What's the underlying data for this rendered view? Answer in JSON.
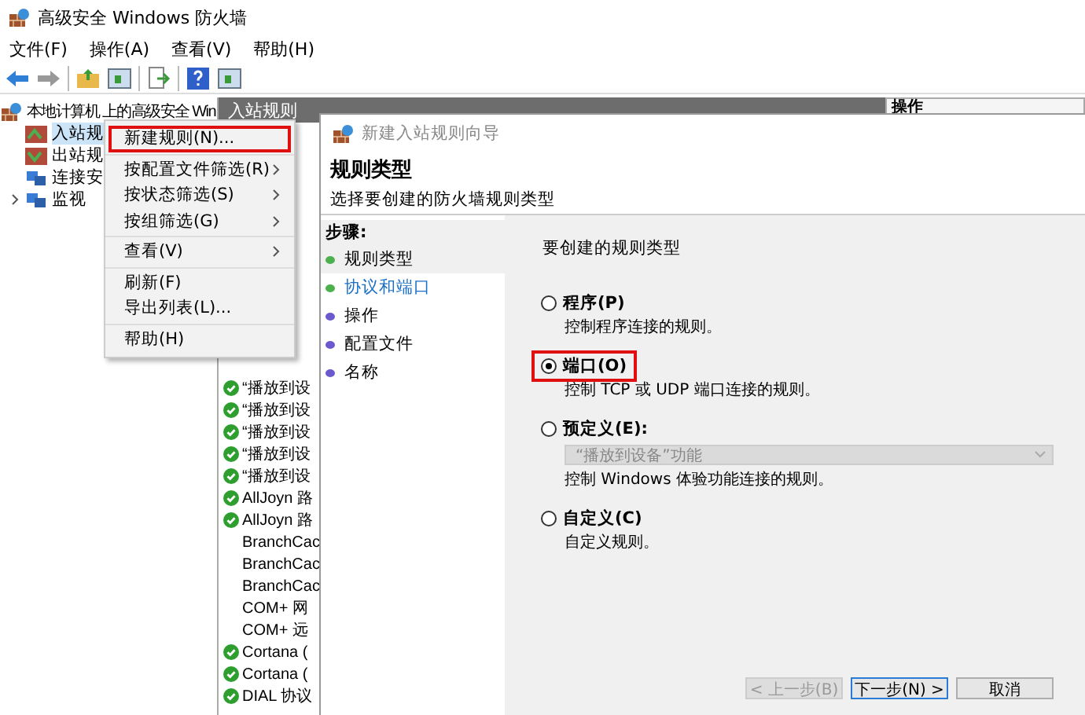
{
  "window": {
    "title": "高级安全 Windows 防火墙"
  },
  "menu_bar": [
    "文件(F)",
    "操作(A)",
    "查看(V)",
    "帮助(H)"
  ],
  "tree": {
    "root": "本地计算机 上的高级安全 Win",
    "children": [
      {
        "label": "入站规",
        "expandable": false,
        "selected": true
      },
      {
        "label": "出站规",
        "expandable": false,
        "selected": false
      },
      {
        "label": "连接安",
        "expandable": false,
        "selected": false
      },
      {
        "label": "监视",
        "expandable": true,
        "selected": false
      }
    ]
  },
  "middle_pane": {
    "title": "入站规则",
    "rows": [
      {
        "name": "“播放到设",
        "enabled": true
      },
      {
        "name": "“播放到设",
        "enabled": true
      },
      {
        "name": "“播放到设",
        "enabled": true
      },
      {
        "name": "“播放到设",
        "enabled": true
      },
      {
        "name": "“播放到设",
        "enabled": true
      },
      {
        "name": "AllJoyn 路",
        "enabled": true
      },
      {
        "name": "AllJoyn 路",
        "enabled": true
      },
      {
        "name": "BranchCac",
        "enabled": false
      },
      {
        "name": "BranchCac",
        "enabled": false
      },
      {
        "name": "BranchCac",
        "enabled": false
      },
      {
        "name": "COM+ 网",
        "enabled": false
      },
      {
        "name": "COM+ 远",
        "enabled": false
      },
      {
        "name": "Cortana (",
        "enabled": true
      },
      {
        "name": "Cortana (",
        "enabled": true
      },
      {
        "name": "DIAL 协议",
        "enabled": true
      }
    ]
  },
  "actions_pane": {
    "title": "操作"
  },
  "context_menu": {
    "groups": [
      [
        {
          "label": "新建规则(N)...",
          "submenu": false,
          "highlighted": true
        }
      ],
      [
        {
          "label": "按配置文件筛选(R)",
          "submenu": true,
          "highlighted": false
        },
        {
          "label": "按状态筛选(S)",
          "submenu": true,
          "highlighted": false
        },
        {
          "label": "按组筛选(G)",
          "submenu": true,
          "highlighted": false
        }
      ],
      [
        {
          "label": "查看(V)",
          "submenu": true,
          "highlighted": false
        }
      ],
      [
        {
          "label": "刷新(F)",
          "submenu": false,
          "highlighted": false
        },
        {
          "label": "导出列表(L)...",
          "submenu": false,
          "highlighted": false
        }
      ],
      [
        {
          "label": "帮助(H)",
          "submenu": false,
          "highlighted": false
        }
      ]
    ]
  },
  "wizard": {
    "title": "新建入站规则向导",
    "heading": "规则类型",
    "subheading": "选择要创建的防火墙规则类型",
    "steps_title": "步骤:",
    "steps": [
      {
        "label": "规则类型",
        "color": "#4cb04c",
        "selected": true,
        "link": false
      },
      {
        "label": "协议和端口",
        "color": "#4cb04c",
        "selected": false,
        "link": true
      },
      {
        "label": "操作",
        "color": "#6a5acd",
        "selected": false,
        "link": false
      },
      {
        "label": "配置文件",
        "color": "#6a5acd",
        "selected": false,
        "link": false
      },
      {
        "label": "名称",
        "color": "#6a5acd",
        "selected": false,
        "link": false
      }
    ],
    "prompt": "要创建的规则类型",
    "options": [
      {
        "label": "程序(P)",
        "description": "控制程序连接的规则。",
        "selected": false,
        "highlighted": false
      },
      {
        "label": "端口(O)",
        "description": "控制 TCP 或 UDP 端口连接的规则。",
        "selected": true,
        "highlighted": true
      },
      {
        "label": "预定义(E):",
        "dropdown": {
          "value": "“播放到设备”功能",
          "disabled": true
        },
        "description": "控制 Windows 体验功能连接的规则。",
        "selected": false,
        "highlighted": false
      },
      {
        "label": "自定义(C)",
        "description": "自定义规则。",
        "selected": false,
        "highlighted": false
      }
    ],
    "buttons": [
      {
        "label": "< 上一步(B)",
        "disabled": true,
        "focused": false
      },
      {
        "label": "下一步(N) >",
        "disabled": false,
        "focused": true
      },
      {
        "label": "取消",
        "disabled": false,
        "focused": false
      }
    ]
  }
}
